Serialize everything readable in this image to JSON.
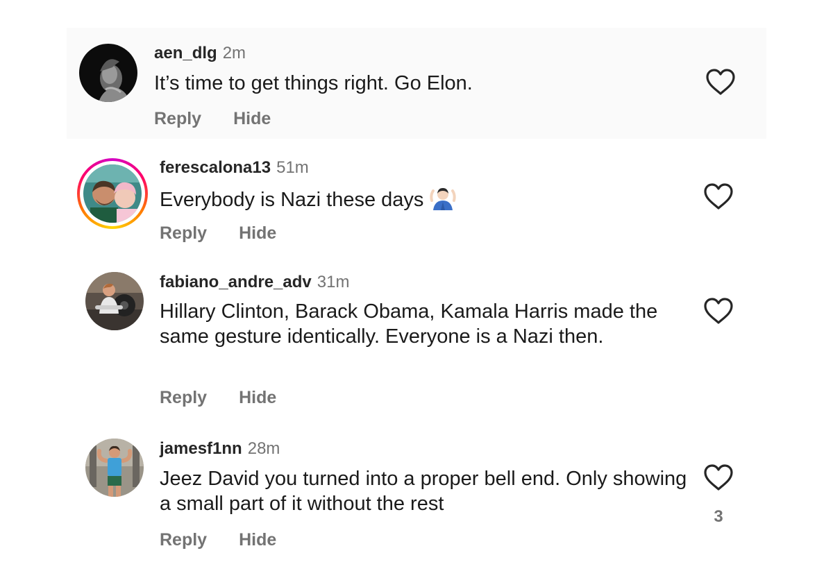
{
  "comments": [
    {
      "username": "aen_dlg",
      "time": "2m",
      "text": "It’s time to get things right. Go Elon.",
      "reply_label": "Reply",
      "hide_label": "Hide",
      "avatar_icon": "statue-avatar",
      "like_icon": "heart-outline-icon"
    },
    {
      "username": "ferescalona13",
      "time": "51m",
      "text": "Everybody is Nazi these days",
      "emoji_icon": "person-shrugging-emoji",
      "reply_label": "Reply",
      "hide_label": "Hide",
      "avatar_icon": "selfie-avatar",
      "has_story_ring": true,
      "like_icon": "heart-outline-icon"
    },
    {
      "username": "fabiano_andre_adv",
      "time": "31m",
      "text": "Hillary Clinton, Barack Obama, Kamala Harris made the same gesture identically. Everyone is a Nazi then.",
      "reply_label": "Reply",
      "hide_label": "Hide",
      "avatar_icon": "gym-photo-avatar",
      "like_icon": "heart-outline-icon"
    },
    {
      "username": "jamesf1nn",
      "time": "28m",
      "text": "Jeez David you turned into a proper bell end. Only showing a small part of it without the rest",
      "reply_label": "Reply",
      "hide_label": "Hide",
      "avatar_icon": "gym-flex-avatar",
      "like_icon": "heart-outline-icon",
      "like_count": "3"
    }
  ],
  "colors": {
    "username": "#262626",
    "secondary_text": "#737373",
    "highlight_background": "#fafafa"
  }
}
